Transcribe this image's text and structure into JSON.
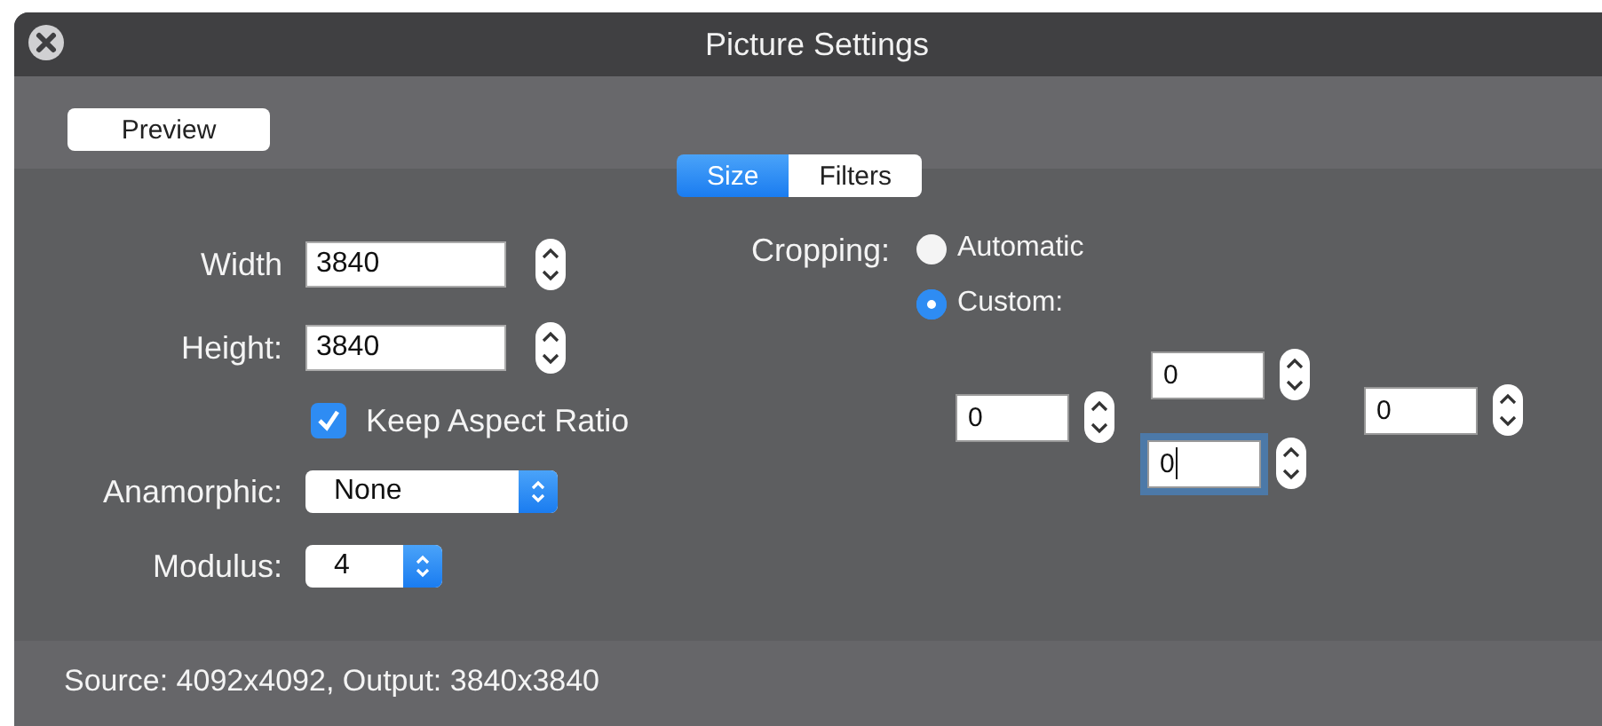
{
  "window": {
    "title": "Picture Settings"
  },
  "preview_button": "Preview",
  "tabs": [
    {
      "label": "Size",
      "selected": true
    },
    {
      "label": "Filters",
      "selected": false
    }
  ],
  "size": {
    "width": {
      "label": "Width",
      "value": "3840"
    },
    "height": {
      "label": "Height:",
      "value": "3840"
    },
    "keep_aspect": {
      "label": "Keep Aspect Ratio",
      "checked": true
    },
    "anamorphic": {
      "label": "Anamorphic:",
      "value": "None"
    },
    "modulus": {
      "label": "Modulus:",
      "value": "4"
    }
  },
  "cropping": {
    "label": "Cropping:",
    "options": [
      {
        "label": "Automatic",
        "selected": false
      },
      {
        "label": "Custom:",
        "selected": true
      }
    ],
    "fields": [
      {
        "kind": "top",
        "value": "0",
        "focused": false
      },
      {
        "kind": "left",
        "value": "0",
        "focused": false
      },
      {
        "kind": "right",
        "value": "0",
        "focused": false
      },
      {
        "kind": "bottom",
        "value": "0",
        "focused": true
      }
    ]
  },
  "status_bar": "Source: 4092x4092, Output: 3840x3840"
}
